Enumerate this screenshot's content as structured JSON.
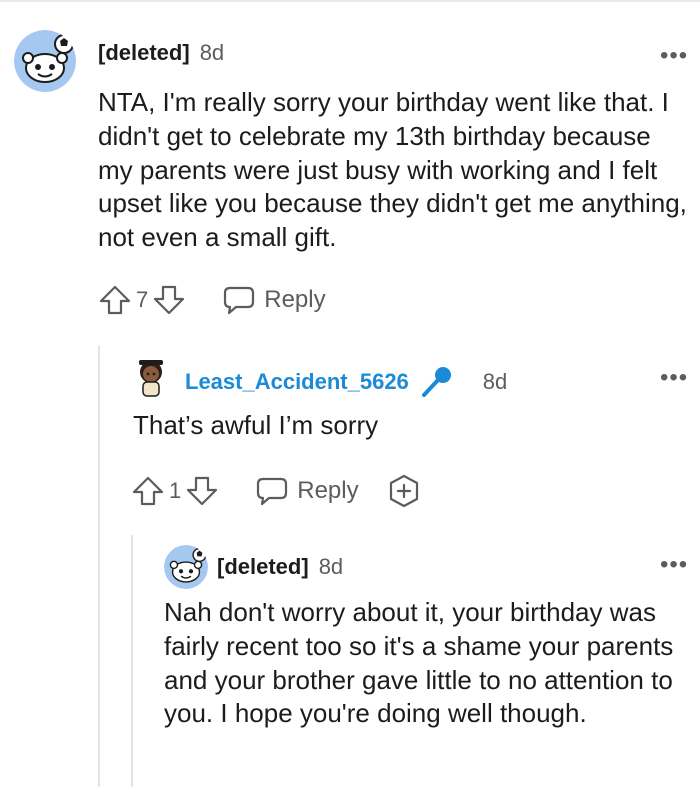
{
  "comments": [
    {
      "author": "[deleted]",
      "timestamp": "8d",
      "text": "NTA, I'm really sorry your birthday went like that. I didn't get to celebrate my 13th birthday because my parents were just busy with working and I felt upset like you because they didn't get me anything, not even a small gift.",
      "votes": "7",
      "reply_label": "Reply",
      "more_label": "•••",
      "avatar_icon": "snoo-avatar-icon"
    },
    {
      "author": "Least_Accident_5626",
      "timestamp": "8d",
      "text": "That’s awful I’m sorry",
      "votes": "1",
      "reply_label": "Reply",
      "more_label": "•••",
      "badge_icon": "microphone-icon",
      "award_icon": "award-plus-icon"
    },
    {
      "author": "[deleted]",
      "timestamp": "8d",
      "text": "Nah don't worry about it, your birthday was fairly recent too so it's a shame your parents and your brother gave little to no attention to you. I hope you're doing well though.",
      "more_label": "•••",
      "avatar_icon": "snoo-avatar-icon"
    }
  ],
  "colors": {
    "author_accent": "#1c8ad8",
    "meta_gray": "#5c5c5c",
    "thread_line": "#e4e4e4"
  }
}
